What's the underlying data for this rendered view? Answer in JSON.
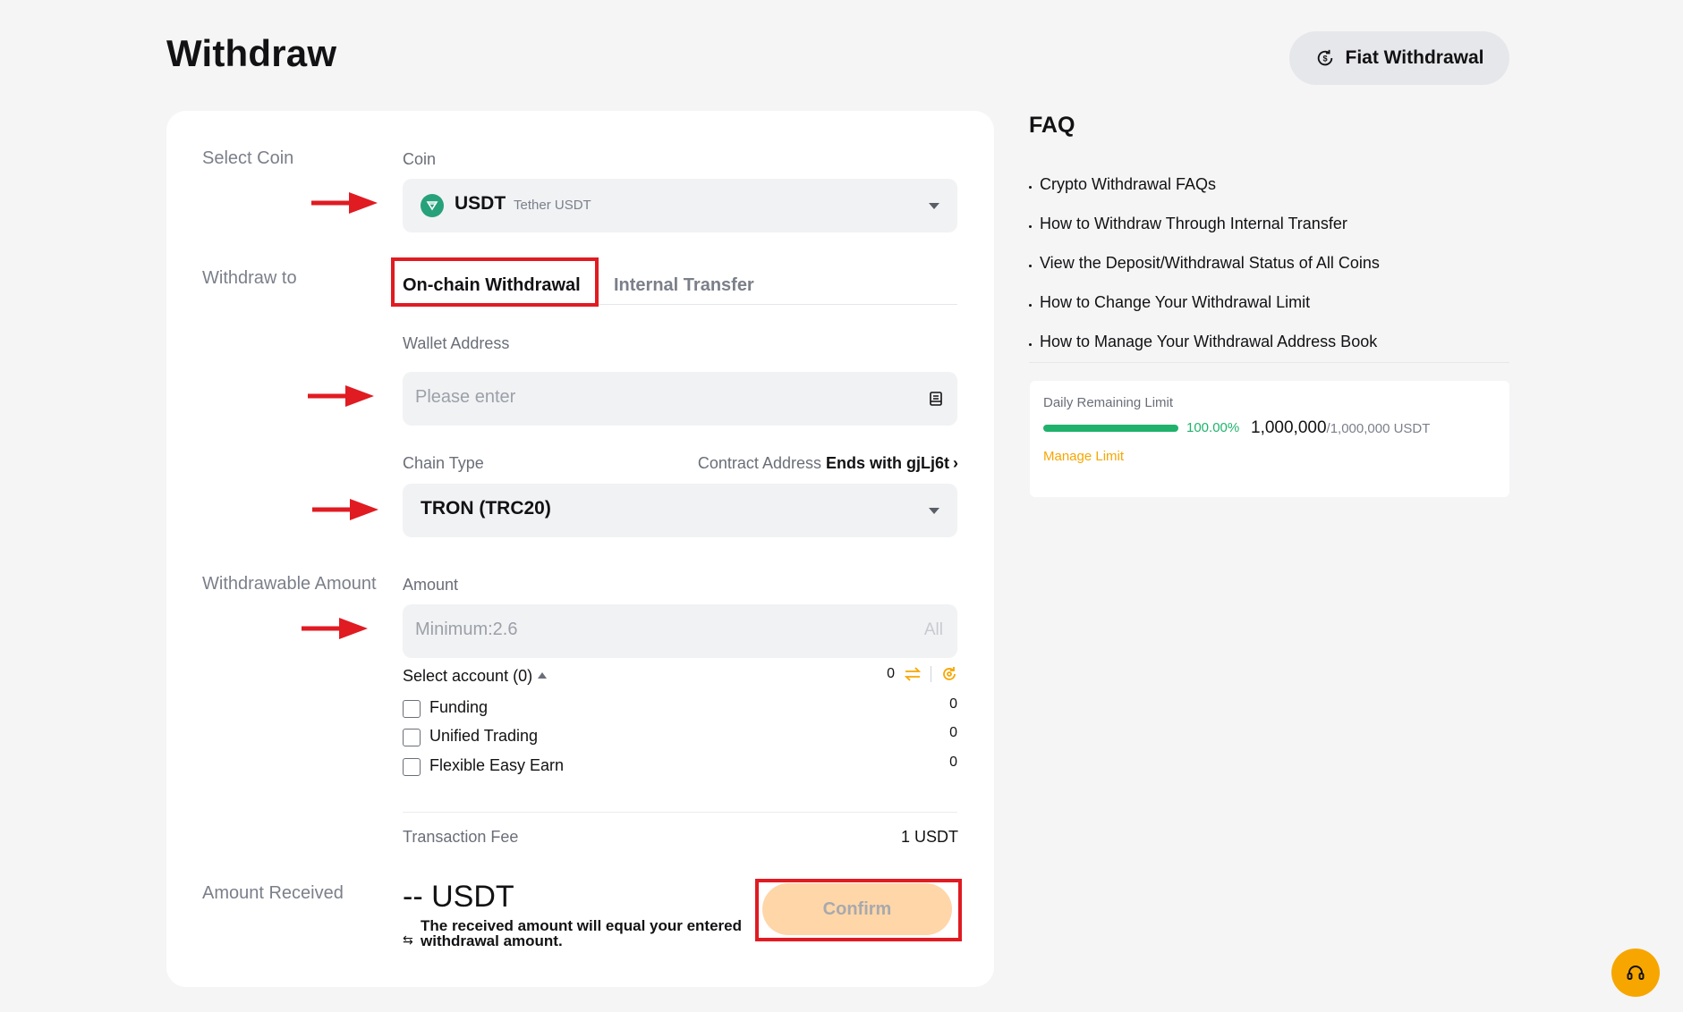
{
  "page": {
    "title": "Withdraw"
  },
  "header": {
    "fiat_button_label": "Fiat Withdrawal"
  },
  "form": {
    "select_coin_label": "Select Coin",
    "coin_field_label": "Coin",
    "coin_symbol": "USDT",
    "coin_name": "Tether USDT",
    "withdraw_to_label": "Withdraw to",
    "tabs": [
      {
        "label": "On-chain Withdrawal",
        "active": true
      },
      {
        "label": "Internal Transfer",
        "active": false
      }
    ],
    "wallet_address_label": "Wallet Address",
    "wallet_address_placeholder": "Please enter",
    "chain_type_label": "Chain Type",
    "contract_address_label": "Contract Address",
    "contract_address_value": "Ends with gjLj6t",
    "chain_type_value": "TRON (TRC20)",
    "withdrawable_amount_label": "Withdrawable Amount",
    "amount_label": "Amount",
    "amount_placeholder": "Minimum:2.6",
    "all_label": "All",
    "select_account_label": "Select account (0)",
    "select_account_total": "0",
    "accounts": [
      {
        "name": "Funding",
        "value": "0"
      },
      {
        "name": "Unified Trading",
        "value": "0"
      },
      {
        "name": "Flexible Easy Earn",
        "value": "0"
      }
    ],
    "transaction_fee_label": "Transaction Fee",
    "transaction_fee_value": "1 USDT",
    "amount_received_label": "Amount Received",
    "amount_received_value": "-- USDT",
    "received_note": "The received amount will equal your entered withdrawal amount.",
    "confirm_label": "Confirm"
  },
  "faq": {
    "title": "FAQ",
    "items": [
      "Crypto Withdrawal FAQs",
      "How to Withdraw Through Internal Transfer",
      "View the Deposit/Withdrawal Status of All Coins",
      "How to Change Your Withdrawal Limit",
      "How to Manage Your Withdrawal Address Book"
    ]
  },
  "limit": {
    "label": "Daily Remaining Limit",
    "percent": "100.00%",
    "remaining_fraction": 1.0,
    "remaining": "1,000,000",
    "total": "/1,000,000 USDT",
    "manage_label": "Manage Limit"
  },
  "colors": {
    "accent": "#f7a600",
    "success": "#20b26c",
    "annotation_red": "#e01b22",
    "confirm_disabled": "#ffd6a8",
    "coin_icon": "#27a17a"
  },
  "icons": {
    "fiat": "dollar-cycle-icon",
    "coin": "tether-icon",
    "address_book": "address-book-icon",
    "transfer": "transfer-icon",
    "refresh": "refresh-icon",
    "support": "headset-icon"
  }
}
